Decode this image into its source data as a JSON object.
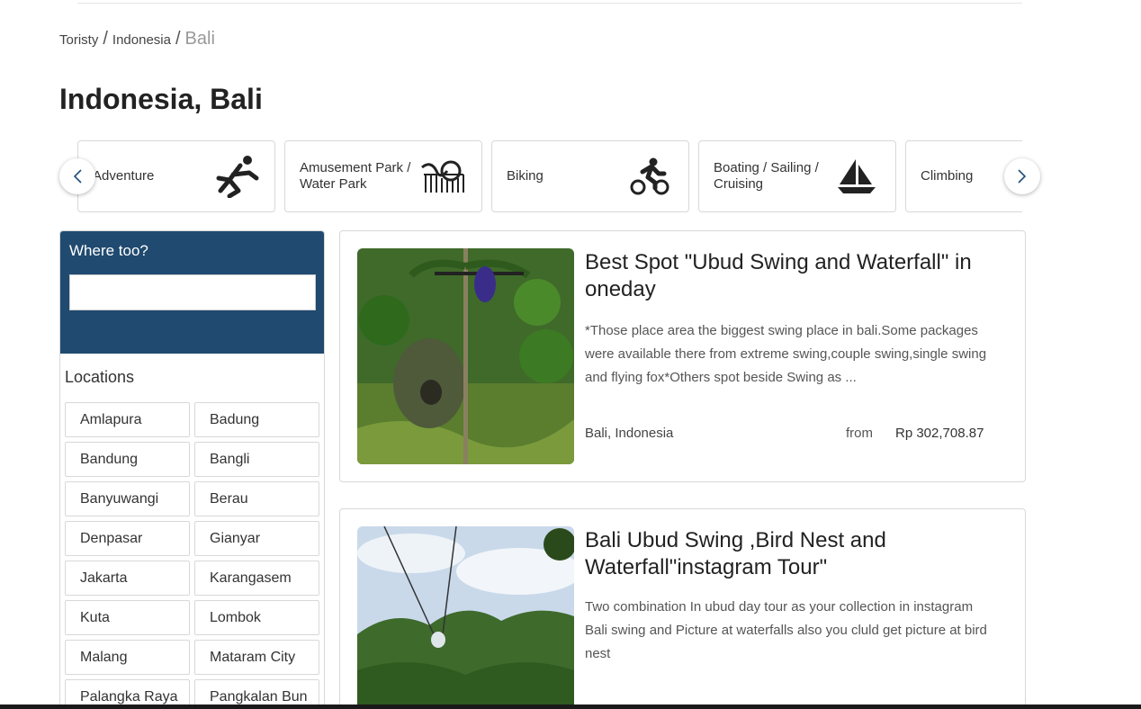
{
  "breadcrumb": {
    "root": "Toristy",
    "country": "Indonesia",
    "current": "Bali",
    "separator": "/"
  },
  "page_title": "Indonesia, Bali",
  "categories": [
    {
      "label": "Adventure",
      "icon": "skydiver-icon"
    },
    {
      "label": "Amusement Park / Water Park",
      "icon": "rollercoaster-icon"
    },
    {
      "label": "Biking",
      "icon": "cyclist-icon"
    },
    {
      "label": "Boating / Sailing / Cruising",
      "icon": "sailboat-icon"
    },
    {
      "label": "Climbing",
      "icon": "climber-icon"
    }
  ],
  "search": {
    "label": "Where too?",
    "value": "",
    "placeholder": ""
  },
  "locations": {
    "title": "Locations",
    "items": [
      "Amlapura",
      "Badung",
      "Bandung",
      "Bangli",
      "Banyuwangi",
      "Berau",
      "Denpasar",
      "Gianyar",
      "Jakarta",
      "Karangasem",
      "Kuta",
      "Lombok",
      "Malang",
      "Mataram City",
      "Palangka Raya",
      "Pangkalan Bun"
    ]
  },
  "tours": [
    {
      "title": "Best Spot \"Ubud Swing and Waterfall\" in oneday",
      "description": "*Those place area the biggest swing place in bali.Some packages were available there from extreme swing,couple swing,single swing and flying fox*Others spot beside Swing as ...",
      "location": "Bali, Indonesia",
      "from_label": "from",
      "price": "Rp 302,708.87"
    },
    {
      "title": "Bali Ubud Swing ,Bird Nest and Waterfall\"instagram Tour\"",
      "description": "Two combination In ubud day tour as your collection in instagram Bali swing and Picture at waterfalls also you cluld get picture at bird nest"
    }
  ],
  "colors": {
    "accent": "#204a70",
    "border": "#d8d8d8",
    "arrow": "#1d4f7a"
  }
}
